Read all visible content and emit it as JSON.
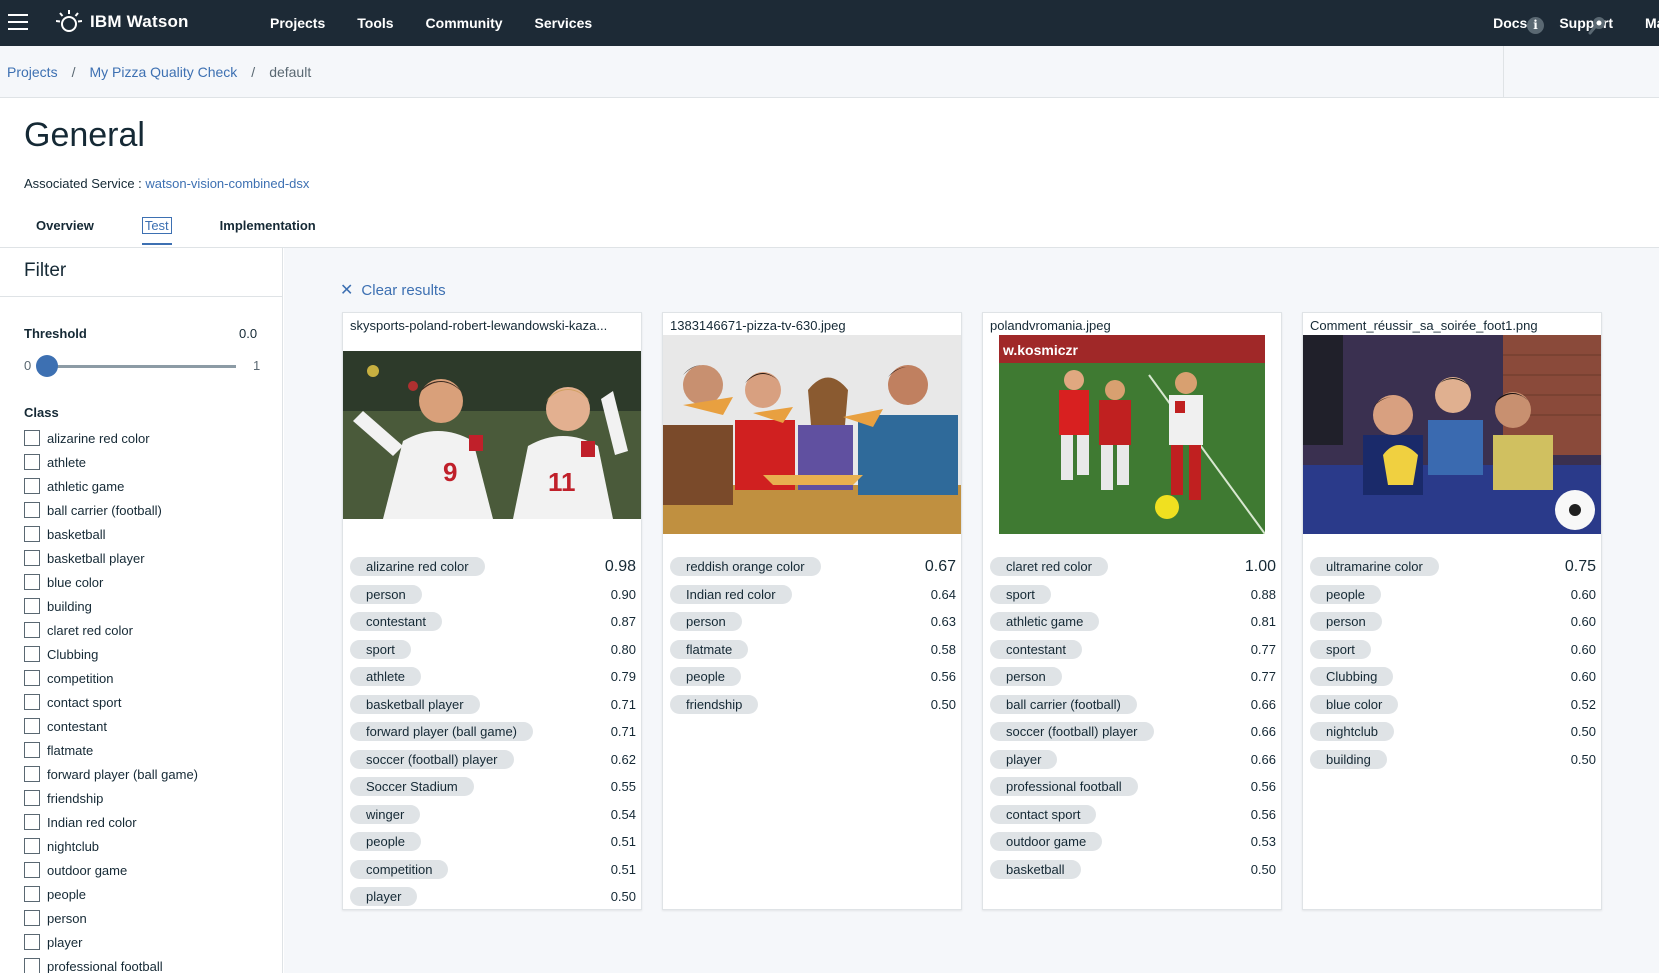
{
  "topnav": {
    "brand": "IBM Watson",
    "items": [
      "Projects",
      "Tools",
      "Community",
      "Services"
    ],
    "right_items": [
      "Docs",
      "Support",
      "Ma"
    ]
  },
  "breadcrumb": {
    "items": [
      "Projects",
      "My Pizza Quality Check"
    ],
    "current": "default",
    "separator": "/"
  },
  "header": {
    "title": "General",
    "assoc_label": "Associated Service :",
    "assoc_value": "watson-vision-combined-dsx",
    "tabs": [
      "Overview",
      "Test",
      "Implementation"
    ],
    "active_tab": "Test"
  },
  "filter": {
    "title": "Filter",
    "threshold_label": "Threshold",
    "threshold_value": "0.0",
    "slider_min": "0",
    "slider_max": "1",
    "slider_level": 0,
    "class_label": "Class",
    "classes": [
      "alizarine red color",
      "athlete",
      "athletic game",
      "ball carrier (football)",
      "basketball",
      "basketball player",
      "blue color",
      "building",
      "claret red color",
      "Clubbing",
      "competition",
      "contact sport",
      "contestant",
      "flatmate",
      "forward player (ball game)",
      "friendship",
      "Indian red color",
      "nightclub",
      "outdoor game",
      "people",
      "person",
      "player",
      "professional football"
    ]
  },
  "main": {
    "clear_label": "Clear results",
    "cards": [
      {
        "name": "skysports-poland-robert-lewandowski-kaza...",
        "image": "soccer-players-celebrating",
        "results": [
          {
            "tag": "alizarine red color",
            "score": "0.98"
          },
          {
            "tag": "person",
            "score": "0.90"
          },
          {
            "tag": "contestant",
            "score": "0.87"
          },
          {
            "tag": "sport",
            "score": "0.80"
          },
          {
            "tag": "athlete",
            "score": "0.79"
          },
          {
            "tag": "basketball player",
            "score": "0.71"
          },
          {
            "tag": "forward player (ball game)",
            "score": "0.71"
          },
          {
            "tag": "soccer (football) player",
            "score": "0.62"
          },
          {
            "tag": "Soccer Stadium",
            "score": "0.55"
          },
          {
            "tag": "winger",
            "score": "0.54"
          },
          {
            "tag": "people",
            "score": "0.51"
          },
          {
            "tag": "competition",
            "score": "0.51"
          },
          {
            "tag": "player",
            "score": "0.50"
          }
        ]
      },
      {
        "name": "1383146671-pizza-tv-630.jpeg",
        "image": "friends-eating-pizza",
        "results": [
          {
            "tag": "reddish orange color",
            "score": "0.67"
          },
          {
            "tag": "Indian red color",
            "score": "0.64"
          },
          {
            "tag": "person",
            "score": "0.63"
          },
          {
            "tag": "flatmate",
            "score": "0.58"
          },
          {
            "tag": "people",
            "score": "0.56"
          },
          {
            "tag": "friendship",
            "score": "0.50"
          }
        ]
      },
      {
        "name": "polandvromania.jpeg",
        "image": "soccer-match-action",
        "results": [
          {
            "tag": "claret red color",
            "score": "1.00"
          },
          {
            "tag": "sport",
            "score": "0.88"
          },
          {
            "tag": "athletic game",
            "score": "0.81"
          },
          {
            "tag": "contestant",
            "score": "0.77"
          },
          {
            "tag": "person",
            "score": "0.77"
          },
          {
            "tag": "ball carrier (football)",
            "score": "0.66"
          },
          {
            "tag": "soccer (football) player",
            "score": "0.66"
          },
          {
            "tag": "player",
            "score": "0.66"
          },
          {
            "tag": "professional football",
            "score": "0.56"
          },
          {
            "tag": "contact sport",
            "score": "0.56"
          },
          {
            "tag": "outdoor game",
            "score": "0.53"
          },
          {
            "tag": "basketball",
            "score": "0.50"
          }
        ]
      },
      {
        "name": "Comment_réussir_sa_soirée_foot1.png",
        "image": "fans-watching-football",
        "results": [
          {
            "tag": "ultramarine color",
            "score": "0.75"
          },
          {
            "tag": "people",
            "score": "0.60"
          },
          {
            "tag": "person",
            "score": "0.60"
          },
          {
            "tag": "sport",
            "score": "0.60"
          },
          {
            "tag": "Clubbing",
            "score": "0.60"
          },
          {
            "tag": "blue color",
            "score": "0.52"
          },
          {
            "tag": "nightclub",
            "score": "0.50"
          },
          {
            "tag": "building",
            "score": "0.50"
          }
        ]
      }
    ]
  },
  "colors": {
    "topbar": "#1d2a36",
    "link": "#3d70b2",
    "tag_bg": "#dfe3e6",
    "main_bg": "#f5f7fa"
  }
}
